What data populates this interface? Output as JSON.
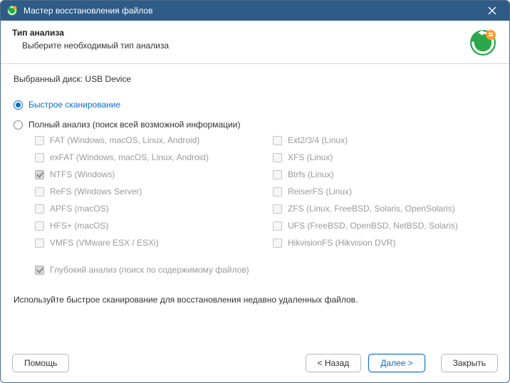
{
  "window": {
    "title": "Мастер восстановления файлов"
  },
  "header": {
    "title": "Тип анализа",
    "subtitle": "Выберите необходимый тип анализа"
  },
  "selected_disk_label": "Выбранный диск:",
  "selected_disk_value": "USB Device",
  "scan_modes": {
    "quick": {
      "label": "Быстрое сканирование",
      "selected": true
    },
    "full": {
      "label": "Полный анализ (поиск всей возможной информации)",
      "selected": false
    }
  },
  "filesystems": {
    "left": [
      {
        "label": "FAT (Windows, macOS, Linux, Android)",
        "checked": false
      },
      {
        "label": "exFAT (Windows, macOS, Linux, Android)",
        "checked": false
      },
      {
        "label": "NTFS (Windows)",
        "checked": true
      },
      {
        "label": "ReFS (Windows Server)",
        "checked": false
      },
      {
        "label": "APFS (macOS)",
        "checked": false
      },
      {
        "label": "HFS+ (macOS)",
        "checked": false
      },
      {
        "label": "VMFS (VMware ESX / ESXi)",
        "checked": false
      }
    ],
    "right": [
      {
        "label": "Ext2/3/4 (Linux)",
        "checked": false
      },
      {
        "label": "XFS (Linux)",
        "checked": false
      },
      {
        "label": "Btrfs (Linux)",
        "checked": false
      },
      {
        "label": "ReiserFS (Linux)",
        "checked": false
      },
      {
        "label": "ZFS (Linux, FreeBSD, Solaris, OpenSolaris)",
        "checked": false
      },
      {
        "label": "UFS (FreeBSD, OpenBSD, NetBSD, Solaris)",
        "checked": false
      },
      {
        "label": "HikvisionFS (Hikvision DVR)",
        "checked": false
      }
    ]
  },
  "deep_analysis": {
    "label": "Глубокий анализ (поиск по содержимому файлов)",
    "checked": true
  },
  "hint": "Используйте быстрое сканирование для восстановления недавно удаленных файлов.",
  "buttons": {
    "help": "Помощь",
    "back": "< Назад",
    "next": "Далее >",
    "close": "Закрыть"
  }
}
